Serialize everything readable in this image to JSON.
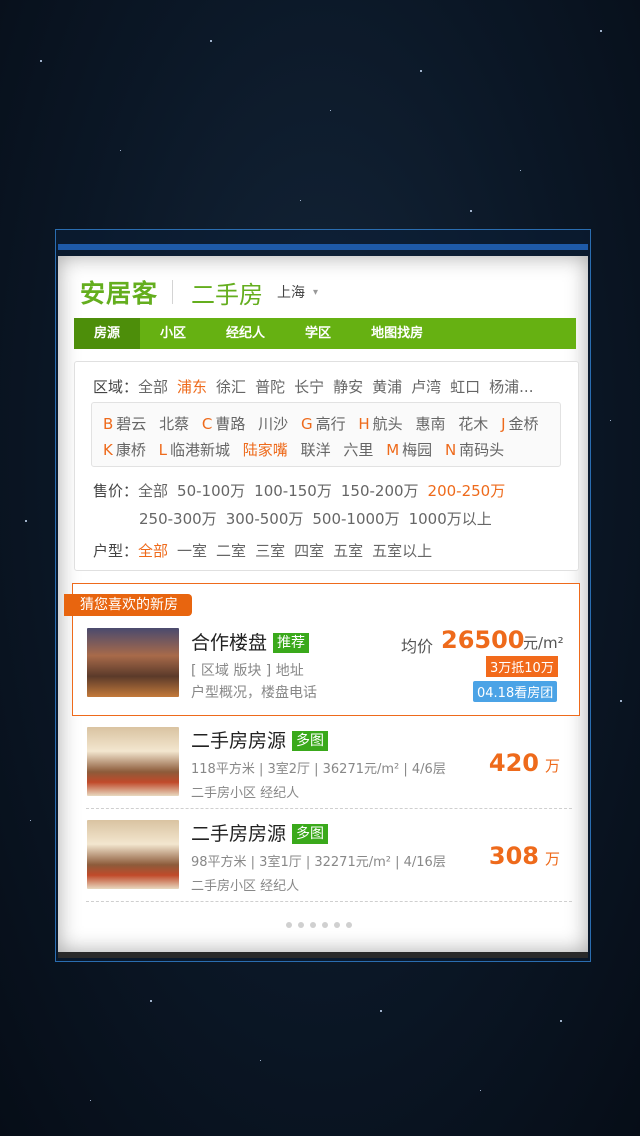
{
  "header": {
    "logo": "安居客",
    "section": "二手房",
    "city": "上海",
    "city_arrow": "▾"
  },
  "nav": [
    "房源",
    "小区",
    "经纪人",
    "学区",
    "地图找房"
  ],
  "filter": {
    "district_label": "区域：",
    "districts": [
      "全部",
      "浦东",
      "徐汇",
      "普陀",
      "长宁",
      "静安",
      "黄浦",
      "卢湾",
      "虹口",
      "杨浦..."
    ],
    "sub_row1": [
      {
        "letter": "B",
        "name": "碧云"
      },
      {
        "letter": "",
        "name": "北蔡"
      },
      {
        "letter": "C",
        "name": "曹路"
      },
      {
        "letter": "",
        "name": "川沙"
      },
      {
        "letter": "G",
        "name": "高行"
      },
      {
        "letter": "H",
        "name": "航头"
      },
      {
        "letter": "",
        "name": "惠南"
      },
      {
        "letter": "",
        "name": "花木"
      },
      {
        "letter": "J",
        "name": "金桥"
      }
    ],
    "sub_row2": [
      {
        "letter": "K",
        "name": "康桥"
      },
      {
        "letter": "L",
        "name": "临港新城"
      },
      {
        "letter": "",
        "name": "陆家嘴"
      },
      {
        "letter": "",
        "name": "联洋"
      },
      {
        "letter": "",
        "name": "六里"
      },
      {
        "letter": "M",
        "name": "梅园"
      },
      {
        "letter": "N",
        "name": "南码头"
      }
    ],
    "price_label": "售价：",
    "prices_row1": [
      "全部",
      "50-100万",
      "100-150万",
      "150-200万",
      "200-250万"
    ],
    "prices_row2": [
      "250-300万",
      "300-500万",
      "500-1000万",
      "1000万以上"
    ],
    "layout_label": "户型：",
    "layouts": [
      "全部",
      "一室",
      "二室",
      "三室",
      "四室",
      "五室",
      "五室以上"
    ]
  },
  "recommend": {
    "ribbon": "猜您喜欢的新房",
    "title": "合作楼盘",
    "tag": "推荐",
    "line1": "[ 区域  版块 ] 地址",
    "line2": "户型概况，楼盘电话",
    "price_label": "均价",
    "price": "26500",
    "price_unit": "元/m²",
    "badge1": "3万抵10万",
    "badge2": "04.18看房团"
  },
  "listings": [
    {
      "title": "二手房房源",
      "tag": "多图",
      "detail": "118平方米 | 3室2厅 | 36271元/m² | 4/6层",
      "meta": "二手房小区    经纪人",
      "price": "420",
      "unit": "万"
    },
    {
      "title": "二手房房源",
      "tag": "多图",
      "detail": "98平方米 | 3室1厅 | 32271元/m² | 4/16层",
      "meta": "二手房小区    经纪人",
      "price": "308",
      "unit": "万"
    }
  ],
  "colors": {
    "brand_green": "#64ae1e",
    "nav_green": "#66b112",
    "accent_orange": "#ee6a1b",
    "badge_blue": "#4ba3e6"
  }
}
